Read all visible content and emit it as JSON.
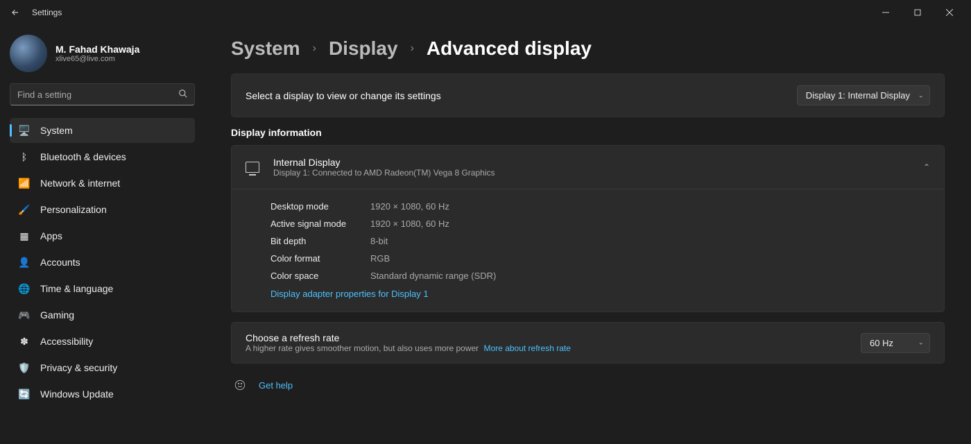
{
  "titlebar": {
    "title": "Settings"
  },
  "profile": {
    "name": "M. Fahad Khawaja",
    "email": "xlive65@live.com"
  },
  "search": {
    "placeholder": "Find a setting"
  },
  "nav": {
    "items": [
      {
        "id": "system",
        "label": "System",
        "icon": "🖥️",
        "icon_name": "monitor-icon"
      },
      {
        "id": "bluetooth",
        "label": "Bluetooth & devices",
        "icon": "ᛒ",
        "icon_name": "bluetooth-icon"
      },
      {
        "id": "network",
        "label": "Network & internet",
        "icon": "📶",
        "icon_name": "wifi-icon"
      },
      {
        "id": "personalization",
        "label": "Personalization",
        "icon": "🖌️",
        "icon_name": "paintbrush-icon"
      },
      {
        "id": "apps",
        "label": "Apps",
        "icon": "▦",
        "icon_name": "apps-icon"
      },
      {
        "id": "accounts",
        "label": "Accounts",
        "icon": "👤",
        "icon_name": "person-icon"
      },
      {
        "id": "time",
        "label": "Time & language",
        "icon": "🌐",
        "icon_name": "globe-icon"
      },
      {
        "id": "gaming",
        "label": "Gaming",
        "icon": "🎮",
        "icon_name": "gamepad-icon"
      },
      {
        "id": "accessibility",
        "label": "Accessibility",
        "icon": "✽",
        "icon_name": "accessibility-icon"
      },
      {
        "id": "privacy",
        "label": "Privacy & security",
        "icon": "🛡️",
        "icon_name": "shield-icon"
      },
      {
        "id": "update",
        "label": "Windows Update",
        "icon": "🔄",
        "icon_name": "update-icon"
      }
    ],
    "active": "system"
  },
  "breadcrumb": {
    "items": [
      {
        "label": "System"
      },
      {
        "label": "Display"
      },
      {
        "label": "Advanced display"
      }
    ]
  },
  "display_select": {
    "caption": "Select a display to view or change its settings",
    "value": "Display 1: Internal Display"
  },
  "section_title": "Display information",
  "display_info": {
    "title": "Internal Display",
    "subtitle": "Display 1: Connected to AMD Radeon(TM) Vega 8 Graphics",
    "rows": [
      {
        "k": "Desktop mode",
        "v": "1920 × 1080, 60 Hz"
      },
      {
        "k": "Active signal mode",
        "v": "1920 × 1080, 60 Hz"
      },
      {
        "k": "Bit depth",
        "v": "8-bit"
      },
      {
        "k": "Color format",
        "v": "RGB"
      },
      {
        "k": "Color space",
        "v": "Standard dynamic range (SDR)"
      }
    ],
    "adapter_link": "Display adapter properties for Display 1"
  },
  "refresh": {
    "title": "Choose a refresh rate",
    "subtitle": "A higher rate gives smoother motion, but also uses more power",
    "more": "More about refresh rate",
    "value": "60 Hz"
  },
  "help": {
    "label": "Get help"
  }
}
